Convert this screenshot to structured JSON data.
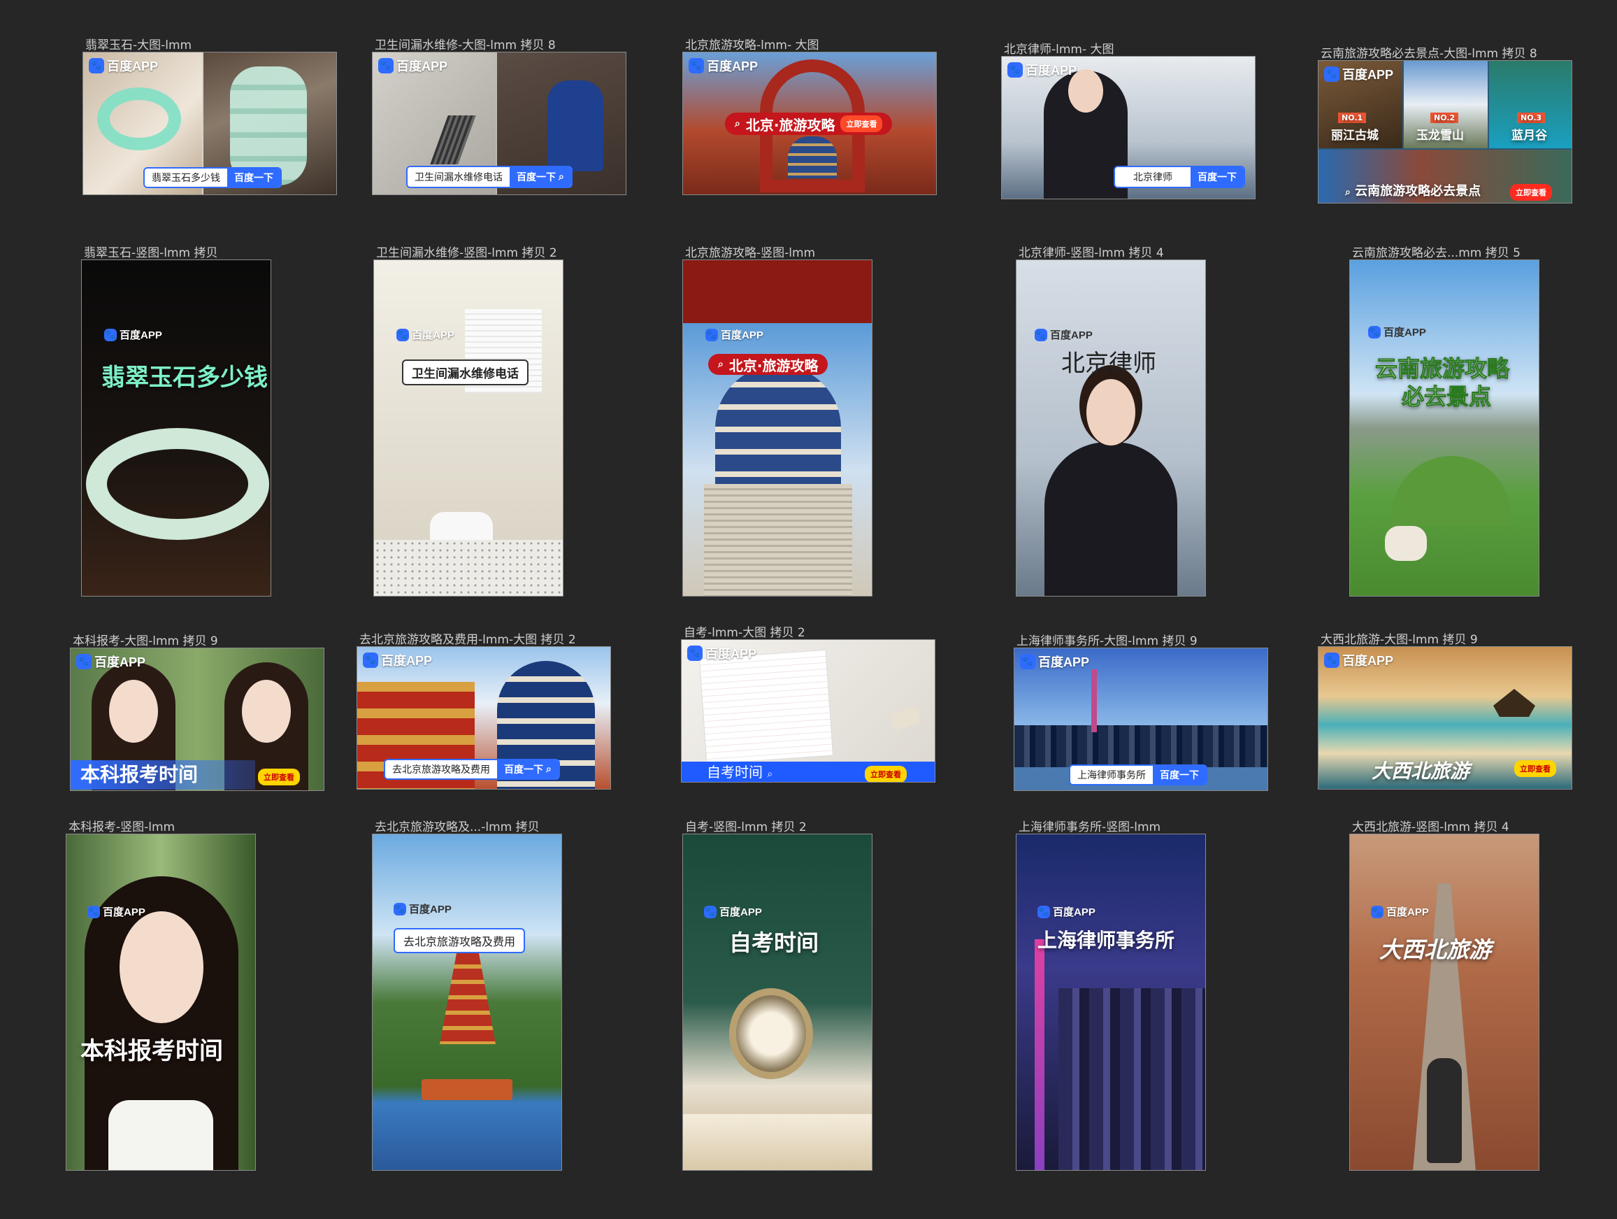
{
  "brand": {
    "logo_text": "百度APP",
    "search_button": "百度一下",
    "cta": "立即查看"
  },
  "rows": [
    [
      {
        "label": "翡翠玉石-大图-lmm",
        "query": "翡翠玉石多少钱"
      },
      {
        "label": "卫生间漏水维修-大图-lmm 拷贝 8",
        "query": "卫生间漏水维修电话"
      },
      {
        "label": "北京旅游攻略-lmm- 大图",
        "query": "北京·旅游攻略"
      },
      {
        "label": "北京律师-lmm- 大图",
        "query": "北京律师"
      },
      {
        "label": "云南旅游攻略必去景点-大图-lmm 拷贝 8",
        "query": "云南旅游攻略必去景点",
        "spots": [
          "丽江古城",
          "玉龙雪山",
          "蓝月谷"
        ],
        "ranks": [
          "NO.1",
          "NO.2",
          "NO.3"
        ]
      }
    ],
    [
      {
        "label": "翡翠玉石-竖图-lmm 拷贝",
        "query": "翡翠玉石多少钱"
      },
      {
        "label": "卫生间漏水维修-竖图-lmm 拷贝 2",
        "query": "卫生间漏水维修电话"
      },
      {
        "label": "北京旅游攻略-竖图-lmm",
        "query": "北京·旅游攻略"
      },
      {
        "label": "北京律师-竖图-lmm 拷贝 4",
        "query": "北京律师"
      },
      {
        "label": "云南旅游攻略必去...mm 拷贝 5",
        "query_line1": "云南旅游攻略",
        "query_line2": "必去景点"
      }
    ],
    [
      {
        "label": "本科报考-大图-lmm 拷贝 9",
        "query": "本科报考时间"
      },
      {
        "label": "去北京旅游攻略及费用-lmm-大图 拷贝 2",
        "query": "去北京旅游攻略及费用"
      },
      {
        "label": "自考-lmm-大图 拷贝 2",
        "query": "自考时间"
      },
      {
        "label": "上海律师事务所-大图-lmm 拷贝 9",
        "query": "上海律师事务所"
      },
      {
        "label": "大西北旅游-大图-lmm 拷贝 9",
        "query": "大西北旅游"
      }
    ],
    [
      {
        "label": "本科报考-竖图-lmm",
        "query": "本科报考时间"
      },
      {
        "label": "去北京旅游攻略及...-lmm 拷贝",
        "query": "去北京旅游攻略及费用"
      },
      {
        "label": "自考-竖图-lmm 拷贝 2",
        "query": "自考时间"
      },
      {
        "label": "上海律师事务所-竖图-lmm",
        "query": "上海律师事务所"
      },
      {
        "label": "大西北旅游-竖图-lmm 拷贝 4",
        "query": "大西北旅游"
      }
    ]
  ]
}
